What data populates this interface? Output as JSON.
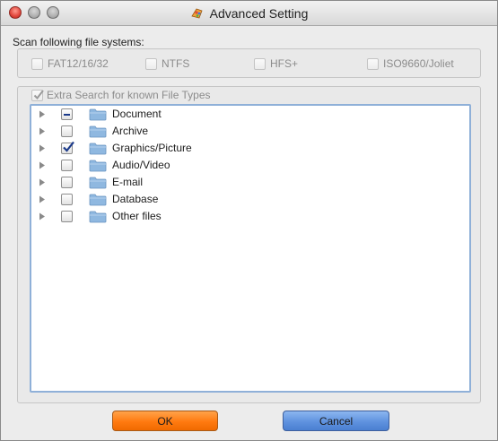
{
  "window": {
    "title": "Advanced Setting",
    "controls": [
      "close",
      "minimize",
      "zoom"
    ]
  },
  "file_systems": {
    "label": "Scan following file systems:",
    "items": [
      {
        "label": "FAT12/16/32",
        "checked": false,
        "enabled": false
      },
      {
        "label": "NTFS",
        "checked": false,
        "enabled": false
      },
      {
        "label": "HFS+",
        "checked": false,
        "enabled": false
      },
      {
        "label": "ISO9660/Joliet",
        "checked": false,
        "enabled": false
      }
    ]
  },
  "extra_search": {
    "label": "Extra Search for known File Types",
    "checked": true,
    "enabled": false
  },
  "file_types": [
    {
      "label": "Document",
      "state": "partial",
      "expanded": false,
      "icon": "folder-icon"
    },
    {
      "label": "Archive",
      "state": "unchecked",
      "expanded": false,
      "icon": "folder-icon"
    },
    {
      "label": "Graphics/Picture",
      "state": "checked",
      "expanded": false,
      "icon": "folder-icon"
    },
    {
      "label": "Audio/Video",
      "state": "unchecked",
      "expanded": false,
      "icon": "folder-icon"
    },
    {
      "label": "E-mail",
      "state": "unchecked",
      "expanded": false,
      "icon": "folder-icon"
    },
    {
      "label": "Database",
      "state": "unchecked",
      "expanded": false,
      "icon": "folder-icon"
    },
    {
      "label": "Other files",
      "state": "unchecked",
      "expanded": false,
      "icon": "folder-icon"
    }
  ],
  "buttons": {
    "ok": "OK",
    "cancel": "Cancel"
  },
  "colors": {
    "ok_button": "#ff7a10",
    "cancel_button": "#5f92df",
    "list_border": "#8fb0d8",
    "checkmark": "#1b3a8a",
    "folder": "#8fb8e0"
  }
}
